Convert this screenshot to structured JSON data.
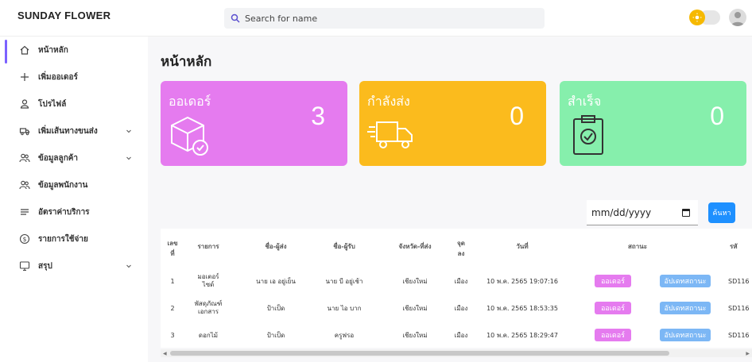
{
  "brand": "SUNDAY FLOWER",
  "search": {
    "placeholder": "Search for name"
  },
  "sidebar": {
    "items": [
      {
        "label": "หน้าหลัก",
        "icon": "home-icon",
        "active": true,
        "chevron": false
      },
      {
        "label": "เพิ่มออเดอร์",
        "icon": "plus-icon",
        "active": false,
        "chevron": false
      },
      {
        "label": "โปรไฟล์",
        "icon": "user-icon",
        "active": false,
        "chevron": false
      },
      {
        "label": "เพิ่มเส้นทางขนส่ง",
        "icon": "truck-icon",
        "active": false,
        "chevron": true
      },
      {
        "label": "ข้อมูลลูกค้า",
        "icon": "users-icon",
        "active": false,
        "chevron": true
      },
      {
        "label": "ข้อมูลพนักงาน",
        "icon": "users-icon",
        "active": false,
        "chevron": false
      },
      {
        "label": "อัตราค่าบริการ",
        "icon": "list-icon",
        "active": false,
        "chevron": false
      },
      {
        "label": "รายการใช้จ่าย",
        "icon": "dollar-icon",
        "active": false,
        "chevron": false
      },
      {
        "label": "สรุป",
        "icon": "monitor-icon",
        "active": false,
        "chevron": true
      }
    ]
  },
  "page": {
    "title": "หน้าหลัก"
  },
  "cards": [
    {
      "label": "ออเดอร์",
      "value": "3",
      "color": "#e57bef",
      "icon": "package-icon"
    },
    {
      "label": "กำลังส่ง",
      "value": "0",
      "color": "#fbbb1d",
      "icon": "delivery-truck-icon"
    },
    {
      "label": "สำเร็จ",
      "value": "0",
      "color": "#86efac",
      "icon": "clipboard-check-icon"
    }
  ],
  "filter": {
    "date_placeholder": "mm/dd/yyyy",
    "search_button": "ค้นหา"
  },
  "table": {
    "headers": [
      "เลข\nที่",
      "รายการ",
      "ชื่อ-ผู้ส่ง",
      "ชื่อ-ผู้รับ",
      "จังหวัด-ที่ส่ง",
      "จุด\nลง",
      "วันที่",
      "สถานะ",
      "รหั"
    ],
    "rows": [
      {
        "no": "1",
        "item": "มอเตอร์\nไซด์",
        "sender": "นาย เอ อยู่เย็น",
        "receiver": "นาย บี อยู่เช้า",
        "province": "เชียงใหม่",
        "drop": "เมือง",
        "date": "10 พ.ค. 2565 19:07:16",
        "status": "ออเดอร์",
        "update": "อัปเดทสถานะ",
        "code": "SD116"
      },
      {
        "no": "2",
        "item": "พัสดุภัณฑ์\nเอกสาร",
        "sender": "ป้าเป็ด",
        "receiver": "นาย ไอ บาก",
        "province": "เชียงใหม่",
        "drop": "เมือง",
        "date": "10 พ.ค. 2565 18:53:35",
        "status": "ออเดอร์",
        "update": "อัปเดทสถานะ",
        "code": "SD116"
      },
      {
        "no": "3",
        "item": "ดอกไม้",
        "sender": "ป้าเป็ด",
        "receiver": "ครูฟรอ",
        "province": "เชียงใหม่",
        "drop": "เมือง",
        "date": "10 พ.ค. 2565 18:29:47",
        "status": "ออเดอร์",
        "update": "อัปเดทสถานะ",
        "code": "SD116"
      }
    ]
  },
  "colors": {
    "accent": "#7b61ff",
    "button": "#1e90ff",
    "status_order": "#e57bef",
    "status_update": "#7cb7f5"
  }
}
